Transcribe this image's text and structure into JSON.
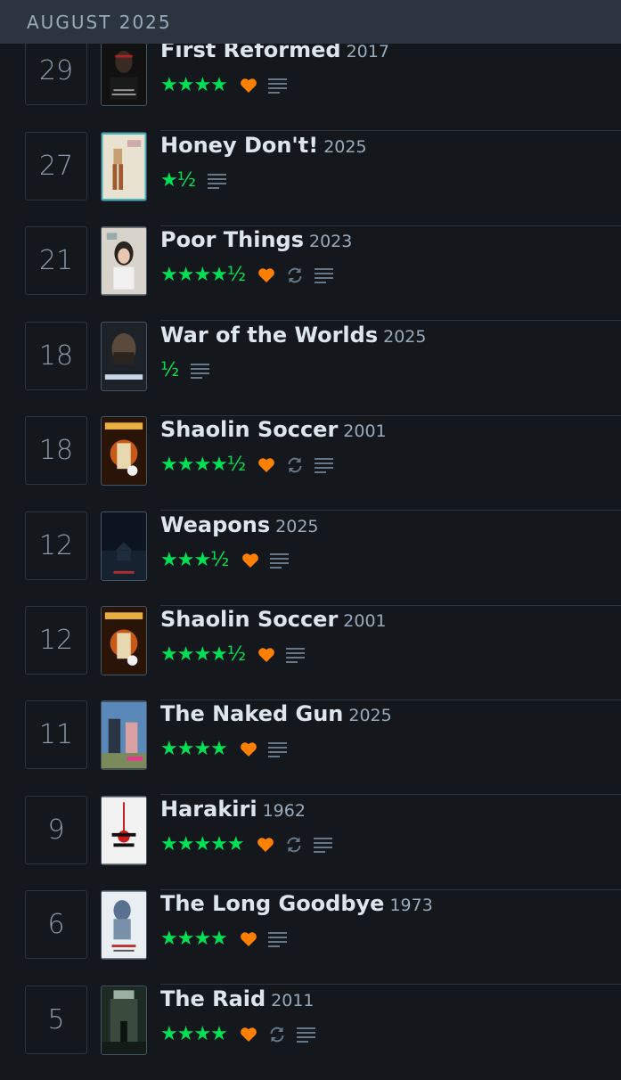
{
  "header": {
    "title": "AUGUST 2025"
  },
  "colors": {
    "star": "#00e054",
    "like": "#ff8000",
    "muted": "#678"
  },
  "entries": [
    {
      "day": "29",
      "title": "First Reformed",
      "year": "2017",
      "rating": "★★★★",
      "liked": true,
      "rewatch": false,
      "review": true,
      "poster": "dark-red-portrait"
    },
    {
      "day": "27",
      "title": "Honey Don't!",
      "year": "2025",
      "rating": "★½",
      "liked": false,
      "rewatch": false,
      "review": true,
      "poster": "light-figure"
    },
    {
      "day": "21",
      "title": "Poor Things",
      "year": "2023",
      "rating": "★★★★½",
      "liked": true,
      "rewatch": true,
      "review": true,
      "poster": "pale-portrait"
    },
    {
      "day": "18",
      "title": "War of the Worlds",
      "year": "2025",
      "rating": "½",
      "liked": false,
      "rewatch": false,
      "review": true,
      "poster": "dark-face"
    },
    {
      "day": "18",
      "title": "Shaolin Soccer",
      "year": "2001",
      "rating": "★★★★½",
      "liked": true,
      "rewatch": true,
      "review": true,
      "poster": "orange-action"
    },
    {
      "day": "12",
      "title": "Weapons",
      "year": "2025",
      "rating": "★★★½",
      "liked": true,
      "rewatch": false,
      "review": true,
      "poster": "night-house"
    },
    {
      "day": "12",
      "title": "Shaolin Soccer",
      "year": "2001",
      "rating": "★★★★½",
      "liked": true,
      "rewatch": false,
      "review": true,
      "poster": "orange-action"
    },
    {
      "day": "11",
      "title": "The Naked Gun",
      "year": "2025",
      "rating": "★★★★",
      "liked": true,
      "rewatch": false,
      "review": true,
      "poster": "blue-pink-action"
    },
    {
      "day": "9",
      "title": "Harakiri",
      "year": "1962",
      "rating": "★★★★★",
      "liked": true,
      "rewatch": true,
      "review": true,
      "poster": "white-red-splash"
    },
    {
      "day": "6",
      "title": "The Long Goodbye",
      "year": "1973",
      "rating": "★★★★",
      "liked": true,
      "rewatch": false,
      "review": true,
      "poster": "pale-blue-portrait"
    },
    {
      "day": "5",
      "title": "The Raid",
      "year": "2011",
      "rating": "★★★★",
      "liked": true,
      "rewatch": true,
      "review": true,
      "poster": "green-building"
    }
  ]
}
